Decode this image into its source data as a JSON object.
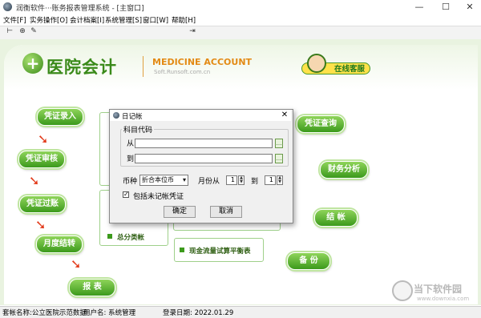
{
  "window": {
    "title": "润衡软件···账务报表管理系统 - [主窗口]",
    "minimize": "—",
    "maximize": "☐",
    "close": "✕"
  },
  "menu": [
    "文件[F]",
    "实务操作[O]",
    "会计档案[I]",
    "系统管理[S]",
    "窗口[W]",
    "帮助[H]"
  ],
  "toolbar": {
    "icons": [
      "tree-icon",
      "lock-icon",
      "edit-icon",
      "exit-icon"
    ],
    "glyphs": [
      "⊢",
      "⊕",
      "✎",
      "⇥"
    ]
  },
  "header": {
    "logo_text": "医院会计",
    "logo_symbol": "+",
    "brand_title": "MEDICINE ACCOUNT",
    "brand_url": "Soft.Runsoft.com.cn",
    "service_label": "在线客服"
  },
  "flow": {
    "arrow": "➘",
    "voucher_entry": "凭证录入",
    "voucher_review": "凭证审核",
    "voucher_post": "凭证过账",
    "month_close": "月度结转",
    "report": "报 表",
    "voucher_query": "凭证查询",
    "finance_analysis": "财务分析",
    "settle": "结 帐",
    "backup": "备 份",
    "general_ledger": "总分类帐",
    "cashflow_balance": "现金流量试算平衡表"
  },
  "dialog": {
    "title": "日记帐",
    "close": "✕",
    "group_title": "科目代码",
    "from_label": "从",
    "to_label": "到",
    "from_value": "",
    "to_value": "",
    "currency_label": "币种",
    "currency_value": "折合本位币",
    "month_from_label": "月份从",
    "month_from_value": "1",
    "month_to_label": "到",
    "month_to_value": "1",
    "include_label": "包括未记帐凭证",
    "include_checked": "✓",
    "ok_label": "确定",
    "cancel_label": "取消"
  },
  "status": {
    "account_set": "套帐名称:公立医院示范数据",
    "user": "用户名: 系统管理",
    "login_date": "登录日期: 2022.01.29"
  },
  "watermark": {
    "text": "当下软件园",
    "url": "www.downxia.com"
  }
}
